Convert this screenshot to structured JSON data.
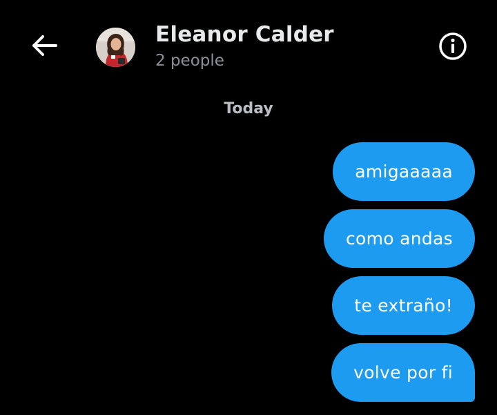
{
  "header": {
    "back_icon": "arrow-left-icon",
    "title": "Eleanor Calder",
    "subtitle": "2 people",
    "info_icon": "info-circle-icon"
  },
  "conversation": {
    "date_separator": "Today",
    "messages": [
      {
        "text": "amigaaaaa",
        "sender": "me"
      },
      {
        "text": "como andas",
        "sender": "me"
      },
      {
        "text": "te extraño!",
        "sender": "me"
      },
      {
        "text": "volve por fi",
        "sender": "me"
      }
    ]
  },
  "colors": {
    "background": "#000000",
    "bubble": "#1d9bf0",
    "title": "#e7e9ea",
    "secondary_text": "#8b9197"
  }
}
